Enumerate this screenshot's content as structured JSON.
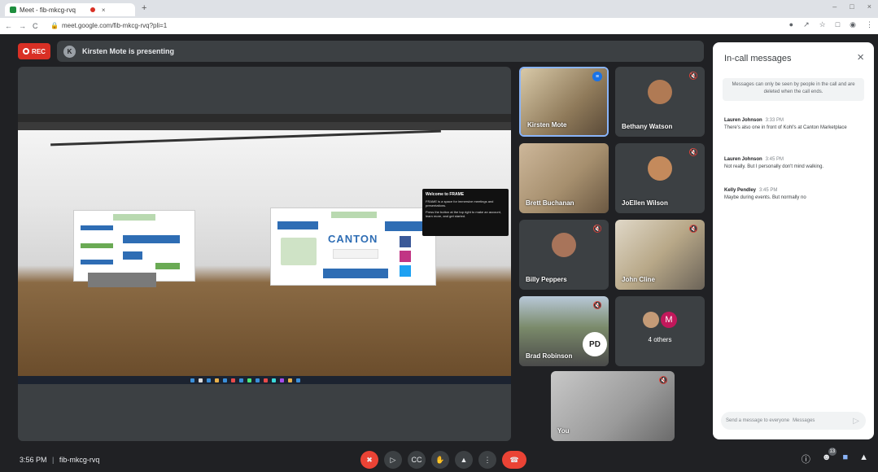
{
  "browser": {
    "tab_title": "Meet - fib-mkcg-rvq",
    "tab_close": "×",
    "new_tab": "+",
    "url": "meet.google.com/fib-mkcg-rvq?pli=1",
    "nav_back": "←",
    "nav_forward": "→",
    "nav_reload": "C",
    "lock": "🔒",
    "window_controls": [
      "–",
      "□",
      "×"
    ]
  },
  "meeting": {
    "rec_label": "REC",
    "presenter_initial": "K",
    "presenting_text": "Kirsten Mote is presenting",
    "time": "3:56 PM",
    "separator": "|",
    "code": "fib-mkcg-rvq",
    "participant_count": "13"
  },
  "shared_screen": {
    "panel_brand": "CANTON",
    "popup_title": "Welcome to FRAME",
    "popup_body_1": "FRAME is a space for immersive meetings and presentations.",
    "popup_body_2": "Press the button at the top right to make an account, learn more, and get started."
  },
  "participants": [
    {
      "name": "Kirsten Mote",
      "muted": false
    },
    {
      "name": "Bethany Watson",
      "muted": true
    },
    {
      "name": "Brett Buchanan",
      "muted": false
    },
    {
      "name": "JoEllen Wilson",
      "muted": true
    },
    {
      "name": "Billy Peppers",
      "muted": true
    },
    {
      "name": "John Cline",
      "muted": true
    },
    {
      "name": "Brad Robinson",
      "muted": true
    },
    {
      "name": "4 others",
      "muted": false
    },
    {
      "name": "You",
      "muted": true
    }
  ],
  "others_avatar_letter": "M",
  "chat": {
    "title": "In-call messages",
    "close": "×",
    "notice": "Messages can only be seen by people in the call and are deleted when the call ends.",
    "messages": [
      {
        "author": "Lauren Johnson",
        "time": "3:33 PM",
        "text": "There's also one in front of Kohl's at Canton Marketplace"
      },
      {
        "author": "Lauren Johnson",
        "time": "3:45 PM",
        "text": "Not really. But I personally don't mind walking."
      },
      {
        "author": "Kelly Pendley",
        "time": "3:45 PM",
        "text": "Maybe during events. But normally no"
      }
    ],
    "input_placeholder": "Send a message to everyone",
    "input_label": "Messages",
    "send_icon": "▷"
  },
  "colors": {
    "accent_red": "#ea4335",
    "rec_red": "#d93025",
    "meet_bg": "#202124",
    "tile_bg": "#3c4043",
    "active_border": "#8ab4f8"
  },
  "icons": {
    "mic_off": "🎙",
    "camera": "▢",
    "captions": "CC",
    "raise_hand": "✋",
    "present": "⬆",
    "more": "⋮",
    "end_call": "☎",
    "info": "ⓘ",
    "people": "👥",
    "chat": "💬",
    "activities": "☖",
    "mic_off_small": "🔇",
    "speaking": "🔊"
  }
}
